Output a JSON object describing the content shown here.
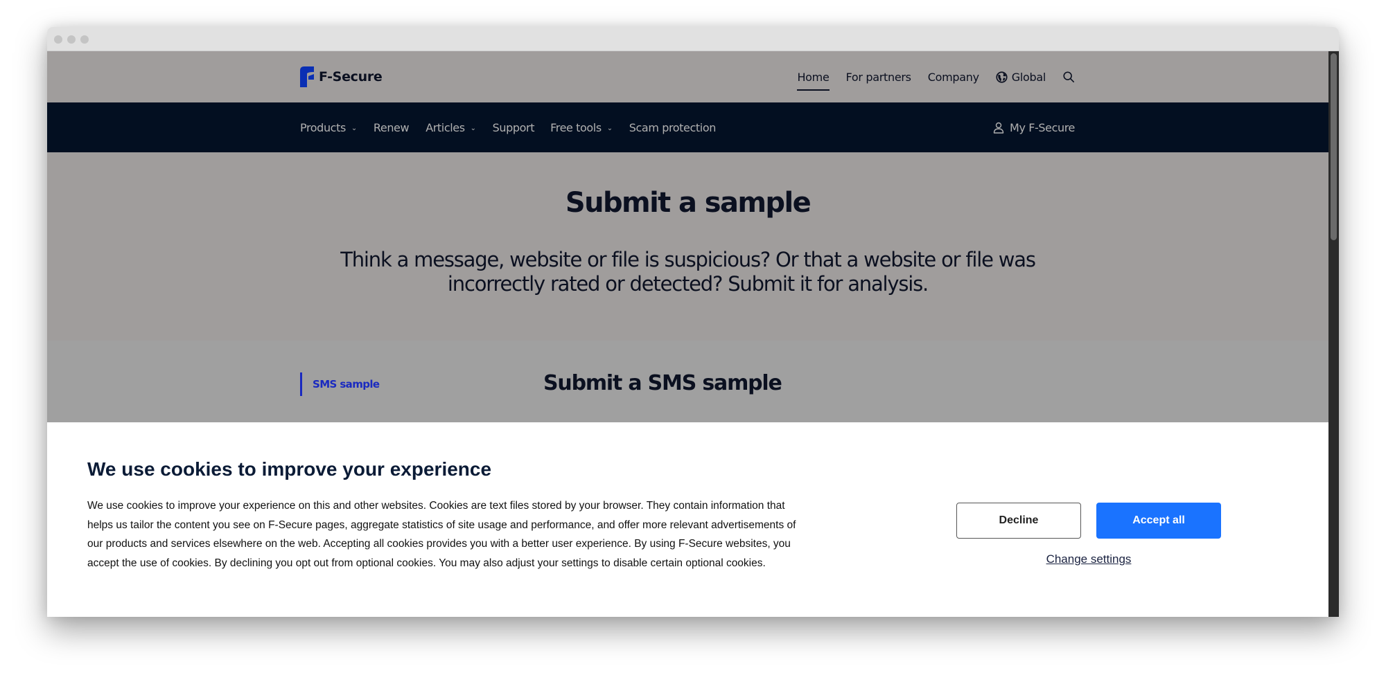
{
  "window": {
    "traffic_lights": [
      "close",
      "minimize",
      "maximize"
    ]
  },
  "header": {
    "logo_text": "F-Secure",
    "logo_color": "#0a2fb4",
    "top_links": [
      {
        "label": "Home",
        "active": true
      },
      {
        "label": "For partners",
        "active": false
      },
      {
        "label": "Company",
        "active": false
      },
      {
        "label": "Global",
        "icon": "globe-icon",
        "active": false
      }
    ],
    "search_icon": "search-icon"
  },
  "nav": {
    "items": [
      {
        "label": "Products",
        "has_dropdown": true
      },
      {
        "label": "Renew",
        "has_dropdown": false
      },
      {
        "label": "Articles",
        "has_dropdown": true
      },
      {
        "label": "Support",
        "has_dropdown": false
      },
      {
        "label": "Free tools",
        "has_dropdown": true
      },
      {
        "label": "Scam protection",
        "has_dropdown": false
      }
    ],
    "account_label": "My F-Secure",
    "account_icon": "user-icon"
  },
  "hero": {
    "title": "Submit a sample",
    "subtitle_line1": "Think a message, website or file is suspicious? Or that a website or file was",
    "subtitle_line2": "incorrectly rated or detected? Submit it for analysis."
  },
  "content": {
    "side_tab": "SMS sample",
    "section_title": "Submit a SMS sample",
    "accent_color": "#1a2ac0"
  },
  "cookie_banner": {
    "title": "We use cookies to improve your experience",
    "text_lines": [
      "We use cookies to improve your experience on this and other websites. Cookies are text files stored by your browser. They contain information that",
      "helps us tailor the content you see on F-Secure pages, aggregate statistics of site usage and performance, and offer more relevant advertisements of",
      "our products and services elsewhere on the web. Accepting all cookies provides you with a better user experience. By using F-Secure websites, you",
      "accept the use of cookies. By declining you opt out from optional cookies. You may also adjust your settings to disable certain optional cookies."
    ],
    "decline_label": "Decline",
    "accept_label": "Accept all",
    "change_settings_label": "Change settings",
    "accept_color": "#1a73ff"
  }
}
